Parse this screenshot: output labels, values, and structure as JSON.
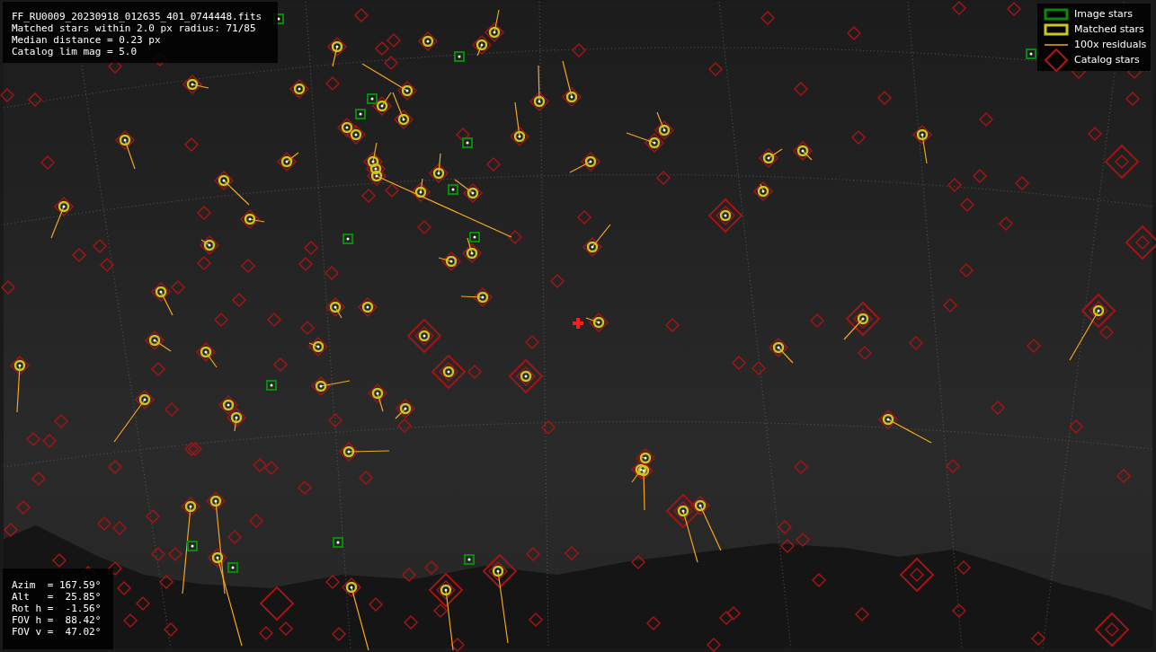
{
  "info_box": {
    "lines": [
      "FF_RU0009_20230918_012635_401_0744448.fits",
      "Matched stars within 2.0 px radius: 71/85",
      "Median distance = 0.23 px",
      "Catalog lim mag = 5.0"
    ]
  },
  "legend": {
    "items": [
      {
        "kind": "image_star",
        "label": "Image stars"
      },
      {
        "kind": "matched_star",
        "label": "Matched stars"
      },
      {
        "kind": "residual",
        "label": "100x residuals"
      },
      {
        "kind": "catalog_star",
        "label": "Catalog stars"
      }
    ]
  },
  "pointing_box": {
    "lines": [
      "Azim  = 167.59°",
      "Alt   =  25.85°",
      "Rot h =  -1.56°",
      "FOV h =  88.42°",
      "FOV v =  47.02°"
    ]
  }
}
